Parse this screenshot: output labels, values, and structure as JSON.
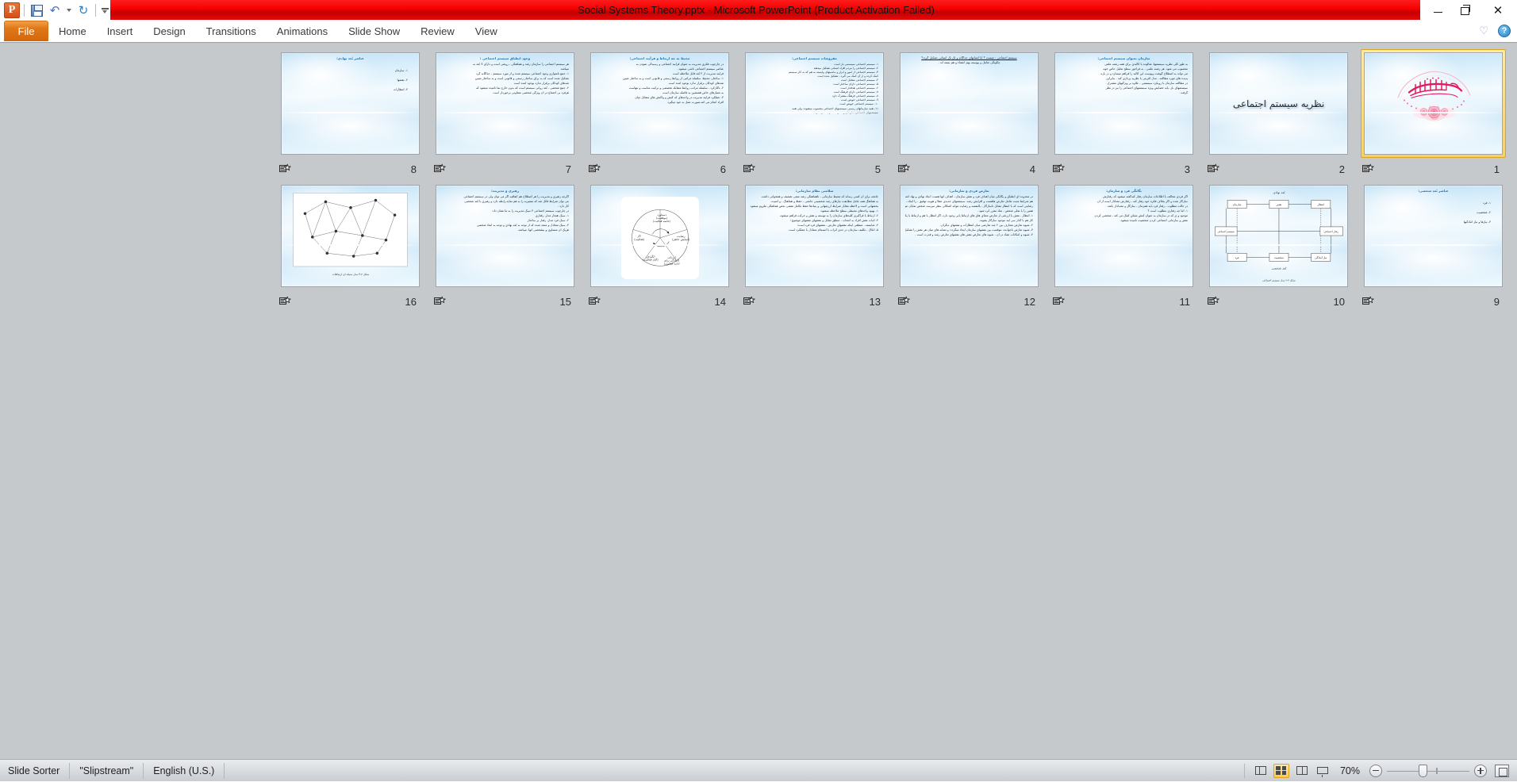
{
  "app": {
    "title": "Social Systems Theory.pptx  -  Microsoft PowerPoint (Product Activation Failed)",
    "accent_red": "#f40000",
    "accent_orange": "#e07818",
    "selection_gold": "#f6d16a"
  },
  "quick_access": {
    "logo": "powerpoint-logo",
    "items": [
      {
        "name": "save",
        "icon": "save-icon",
        "label": "Save"
      },
      {
        "name": "undo",
        "icon": "undo-icon",
        "label": "Undo"
      },
      {
        "name": "undo-dropdown",
        "icon": "chevron-down-icon",
        "label": "Undo options"
      },
      {
        "name": "redo",
        "icon": "redo-icon",
        "label": "Redo"
      },
      {
        "name": "customize",
        "icon": "customize-icon",
        "label": "Customize Quick Access Toolbar"
      }
    ]
  },
  "window_controls": [
    {
      "name": "minimize",
      "icon": "minimize-icon",
      "label": "Minimize"
    },
    {
      "name": "restore",
      "icon": "restore-icon",
      "label": "Restore Down"
    },
    {
      "name": "close",
      "icon": "close-icon",
      "label": "Close"
    }
  ],
  "ribbon": {
    "file_tab": "File",
    "tabs": [
      "Home",
      "Insert",
      "Design",
      "Transitions",
      "Animations",
      "Slide Show",
      "Review",
      "View"
    ],
    "right_icons": [
      {
        "name": "minimize-ribbon",
        "icon": "heart-icon"
      },
      {
        "name": "help",
        "icon": "help-icon",
        "label": "?"
      }
    ]
  },
  "status_bar": {
    "view_name": "Slide Sorter",
    "theme_name": "\"Slipstream\"",
    "language": "English (U.S.)",
    "zoom_level": "70%",
    "view_buttons": [
      {
        "name": "normal-view",
        "icon": "normal-view-icon",
        "active": false
      },
      {
        "name": "slide-sorter-view",
        "icon": "slide-sorter-icon",
        "active": true
      },
      {
        "name": "reading-view",
        "icon": "reading-view-icon",
        "active": false
      },
      {
        "name": "slide-show-view",
        "icon": "slide-show-icon",
        "active": false
      }
    ],
    "zoom_out_label": "Zoom Out",
    "zoom_in_label": "Zoom In",
    "fit_label": "Fit slide to current window"
  },
  "sorter": {
    "selected_slide": 1,
    "rows": [
      [
        8,
        7,
        6,
        5,
        4,
        3,
        2,
        1
      ],
      [
        16,
        15,
        14,
        13,
        12,
        11,
        10,
        9
      ]
    ]
  },
  "slides": {
    "1": {
      "number": "1",
      "kind": "bismillah",
      "title": "",
      "lines": [],
      "alt": "بسم الله الرحمن الرحیم calligraphy with rose ornament"
    },
    "2": {
      "number": "2",
      "kind": "big-title",
      "title": "نظریه سیستم اجتماعی",
      "lines": []
    },
    "3": {
      "number": "3",
      "kind": "text",
      "title": "سازمان بعنوان سیستم اجتماعی:",
      "lines": [
        "به طور کلی نظریه سیستمها، شالوده یا کالبدی برای همه رشته علمی",
        "محسوب می شود. هر رشته علمی ، به فراخور سطح تحلیل خاص خود،",
        "می تواند به اصطلاح گوشت وپوست این کالبد را فراهم میسازد و در باره",
        "پدیده های مورد مطالعه ، مدل آفرینی یا نظریه پردازی کند . بنابراین",
        "در مطالعه سازمان با رویکرد سیستمی ، علاوه بر ویژگیهای مشترک",
        "سیستمهای باز، باید خصایص ویژه سیستمهای اجتماعی را نیز در نظر",
        "گرفت ."
      ]
    },
    "4": {
      "number": "4",
      "kind": "text",
      "title": "",
      "lines": [
        "سیستم  اجتماعی    :   چیست  ؟    آیا انسانهای جداگانه و تک تک انسانی تشکیل گردد؟",
        "چگونگی تعامل و پیوسته بهم اعضاء و هم بسته اند ."
      ],
      "center": true
    },
    "5": {
      "number": "5",
      "kind": "text",
      "title": "مفروضات سیستم اجتماعی:",
      "lines": [
        "۱- سیستم اجتماعی  سیستمی باز است",
        "۲- سیستم اجتماعی را مردم افراد انسانی تشکیل میدهند",
        "۳- سیستم اجتماعی از امور و ابزار و ماشینهای وابسته به هم که به کار سیستم",
        "کمک کرده و از آن کمک می گیرد ، تشکیل شده است",
        "۴- سیستم اجتماعی متقابل است",
        "۵- سیستم اجتماعی دارای ساختار است",
        "۶- سیستم اجتماعی هدفدار است",
        "۷- سیستم اجتماعی دارای فرهنگ است",
        "۸- سیستم اجتماعی فرهنگ مشترک دارد",
        "۹- سیستم اجتماعی خویص  است",
        "۱۰- سیستم اجتماعی خویص  است",
        "۱۱- همه سازمانهای رسمی   سیستمهای  اجتماعی محسوب میشوند، ولی همه",
        "سیستمهای اجتماعی سازمان رسمی محسوب نمی شوند"
      ]
    },
    "6": {
      "number": "6",
      "kind": "text",
      "title": "محیط به چه ارتباط و فرآیند اجتماعی:",
      "lines": [
        "در چارچوب فکری مدیریت به عنوان فرآیند اجتماعی و رسیدگی نمودن به",
        "عناصر سیستم اجتماعی ناشی میشود.",
        "فرآیند مدیریت از ۳ بُعد قابل ملاحظه است",
        "۱- ساختار، محیط، سلسله مراتبی از روابط رسمی و قانونی است و به ساختار تعیین",
        "شدهای کودکان برقرار ندارد بوجود آمده است",
        "۲- ناکارکرد ، سلسله مراتب روابط متقابله تخصصی و ترکیب مناسب و تنهاست",
        "به معیارهای خاص همنشین به فاصله سازمان است",
        "۳- عملکرد فرآیند مدیریت در واحدهای که کنش و واکنش های متقابل میان",
        "افراد انجام می کند،صورت عمل به خود میگیرد"
      ]
    },
    "7": {
      "number": "7",
      "kind": "text",
      "title": "وجود انطباق سیستم اجتماعی :",
      "lines": [
        "هر سیستم اجتماعی را سازمان  رشد و هماهنگی ، روشی است و دارای 3  بُعد به",
        "میباشد",
        "۱- جمع نامتوازی وجود اجتماعی سیستم شده و از مورد سیستم ، جداگانه گرد",
        "تشکیل شده است که به برای ساختار رسمی و قانونی است و به ساختار تعیین",
        "شدهای کودکان برقرار ندارد بوجود آمده است",
        "۲- جمع شخصی ، بُعد روانی سیستم است که بدون خارج نما نامیده میشود که",
        "هرفرد بی اجتماع در آن ویژگی شخصی متفاوتی برخوردار است"
      ]
    },
    "8": {
      "number": "8",
      "kind": "text",
      "title": "عناصر بُعد نهادی:",
      "lines": [
        "۱- سازمان",
        "۲- نقشها",
        "۳- انتظارات"
      ],
      "spaced": true
    },
    "9": {
      "number": "9",
      "kind": "text",
      "title": "عناصر بُعد شخصی:",
      "lines": [
        "۱- فرد",
        "۲- شخصیت",
        "۳- نیازها و نیاز آمادگیها"
      ],
      "spaced": true
    },
    "10": {
      "number": "10",
      "kind": "diagram-boxes",
      "title": "",
      "lines": [],
      "labels": [
        "بُعد نهادی",
        "سازمان",
        "نقش",
        "انتظار",
        "سیستم اجتماعی",
        "رفتار اجتماعی",
        "فرد",
        "شخصیت",
        "نیاز آمادگی",
        "بُعد شخصی"
      ],
      "caption": "شکل ۳-۲ مدل سیستم اجتماعی"
    },
    "11": {
      "number": "11",
      "kind": "text",
      "title": "یگانگی فرد و سازمان:",
      "lines": [
        "اگر فردی مخالف با اطلاعات سازمان رفتار کندگفته میشود که رفتارش",
        "سازگار شده و اگر بخلاف فکره خود رفتار کند ، رفتارش معنادار است از آن",
        "در حالت مطلوب ، رفتار فرد باید همزمان ، سازگار و معنـادار باشد.",
        "۱- اما چه رفتاری مطلوب است ؟",
        "موجود و ی که در سازمان به عنوان کنش ممکن کمک می کند ، شخصی کردن",
        "نقش و سازمانی اجتماعی کردن شخصیت نامیده میشود."
      ]
    },
    "12": {
      "number": "12",
      "kind": "text",
      "title": "تعارض فردی و سازمانی:",
      "lines": [
        "در محدوده ای انطباق و یگانگی میان اهداف فرد و نقش سازمان ، اهداف آنها هست؛ ابعاد نهادی و نهاد اشخاص ،",
        "هم شرایط مثبت تعامل تعارض هاهست و افزایش رشد. سیستمهای جدیدی عقلا و هویت توفیق ، را ایجاد ،",
        "رضایتی است که با انتظار مقابل ناسازگار ، بالنفسه و رضایت نتواند اشکالی بنظر میرسد، شخص نمایان نتواند تماس نماید،",
        "همین را با تجلی شخص ، نماد مقرر کرد شود .",
        "۱- انتظار ، نقش یا ارزشی از تعارض معنای های های ارتباط یابی وجود دارد، اگر انتظار با هم و ارتباط با یکدیگر نیز",
        "کار هم با گذار سر آیند موجود سازگار بشوند.",
        "۲- شیوه تعارض متعارف بین ۲ چند تعارضی میان انتظارات و نقشهای دیگران.",
        "۳- شیوه تعارض ناخوانده، موقعیت بین نقشهای سازمان ایجاد میگردد؛ و نشانه های میان هر نقش را تشکیل میدهند.",
        "۴- شیوه و امکانات تضاد در آن ، شیوه های تعارض نقش های نقشهای تعارض رشد و قدرت است ."
      ]
    },
    "13": {
      "number": "13",
      "kind": "text",
      "title": "سلامتی نظام سازمانی:",
      "lines": [
        "جامعه برای آن کسی رساند که محیط سازمانی ، ناهماهنگی رشد منفی تضعیف و همخوانی داشت",
        "به هماهنگ همه عامل مطابقت نیازهای رشد شخصیتی جامعی ، حفظ و هماهنگ ، و امنیت.",
        "بخشهایی است و لاحظه مقابل شرایط ارزشهایی و بنیادها حفظ تکامل نقشی بخص هماهنگی ملزوم میشود",
        "۱- بهبود واحدهای محیطی سطح ملاحظه میشود،",
        "۲- ارتباط با فراگیری کلیدهای سازمان را به توسعه و نقش و حرکت فراهم میشود،",
        "۳- اثبات نقش افراد به انتخاب ، منطق مقابل و نقشهای نقشهای موضوع ؛",
        "۴- شایسته ، منطقی اینکه نقشهای تعارض ، نقشهای فرد فرد است؛",
        "۵- اتکال ، تکلیف سازمان در حدی اثرات با انسجام متعادل با عملکرد است."
      ]
    },
    "14": {
      "number": "14",
      "kind": "pie",
      "title": "",
      "lines": [],
      "pie_labels": [
        "دستاورد\n(موفقیت)\n(خاتمه فعالیت)",
        "رضایت\n(آسایش خاطر)",
        "ارزیابی\n(آمادگی برای\nادامه فعالیت)",
        "انگیزش\n(آغاز فعالیت)",
        "کار\n(فعالیت)"
      ]
    },
    "15": {
      "number": "15",
      "kind": "text",
      "title": "رهبری و مدیریت:",
      "lines": [
        "اگرچه رهبری و مدیریت را هر اصطلاح هم اتفاقیه اگر می توان ولی در سیستم اجتماعی",
        "می توان شرایط قائل شد که متمیزبه را به هم نماید،رابطه دارد و رهبری با بُعد شخصی",
        "کار دارد .",
        "در چارچوب سیستم اجتماعی ۳ سبک مدیریت را به ما نشان داد:",
        "۱- سبک هنجار مدار، رفتاری",
        "۲- سبک فرد مدار، رفتار بر ساختار",
        "۳- سبک متعادل و متحد شده که از توجه به بُعد نهادی و توجه به ابعاد شخصی",
        "هریک آن متساوی و بیشخصی آنها، میباشد."
      ]
    },
    "16": {
      "number": "16",
      "kind": "diagram-network",
      "title": "",
      "lines": [],
      "caption": "شکل ۳-۴ مدل شبکه ای ارتباطات"
    }
  }
}
